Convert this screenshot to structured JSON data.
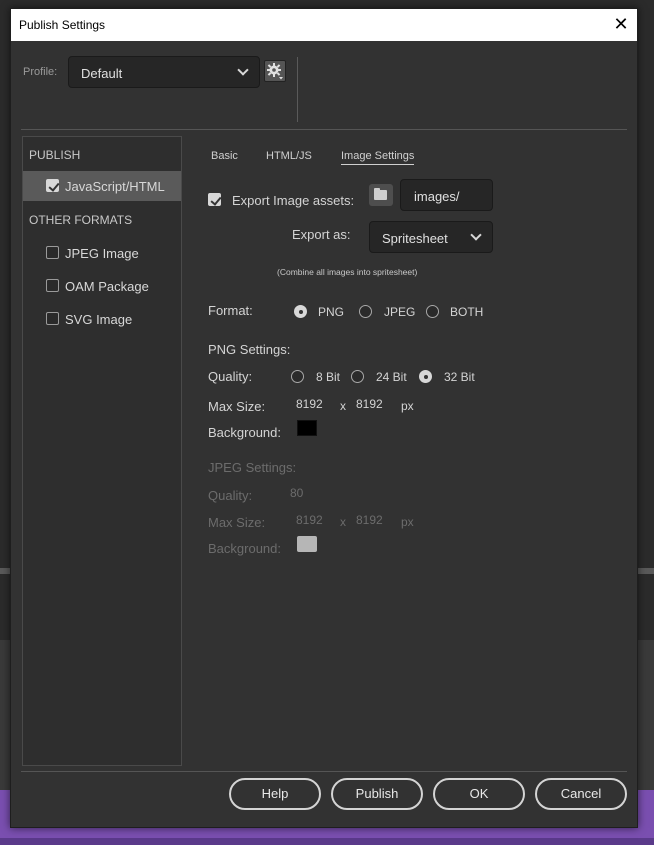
{
  "window": {
    "title": "Publish Settings",
    "close_glyph": "✕"
  },
  "profile": {
    "label": "Profile:",
    "value": "Default"
  },
  "sidebar": {
    "publish_header": "PUBLISH",
    "other_header": "OTHER FORMATS",
    "items": [
      {
        "label": "JavaScript/HTML",
        "checked": true,
        "active": true
      },
      {
        "label": "JPEG Image",
        "checked": false
      },
      {
        "label": "OAM Package",
        "checked": false
      },
      {
        "label": "SVG Image",
        "checked": false
      }
    ]
  },
  "tabs": [
    {
      "label": "Basic",
      "active": false
    },
    {
      "label": "HTML/JS",
      "active": false
    },
    {
      "label": "Image Settings",
      "active": true
    }
  ],
  "export": {
    "label": "Export Image assets:",
    "checked": true,
    "path": "images/",
    "export_as_label": "Export as:",
    "export_as_value": "Spritesheet",
    "note": "(Combine all images into spritesheet)"
  },
  "format": {
    "label": "Format:",
    "options": [
      "PNG",
      "JPEG",
      "BOTH"
    ],
    "selected": "PNG"
  },
  "png": {
    "header": "PNG Settings:",
    "quality_label": "Quality:",
    "quality_options": [
      "8 Bit",
      "24 Bit",
      "32 Bit"
    ],
    "quality_selected": "32 Bit",
    "max_size_label": "Max Size:",
    "width": "8192",
    "x": "x",
    "height": "8192",
    "unit": "px",
    "background_label": "Background:",
    "background_color": "#000000"
  },
  "jpeg": {
    "header": "JPEG Settings:",
    "quality_label": "Quality:",
    "quality_value": "80",
    "max_size_label": "Max Size:",
    "width": "8192",
    "x": "x",
    "height": "8192",
    "unit": "px",
    "background_label": "Background:",
    "background_color": "#b6b6b6"
  },
  "buttons": {
    "help": "Help",
    "publish": "Publish",
    "ok": "OK",
    "cancel": "Cancel"
  }
}
